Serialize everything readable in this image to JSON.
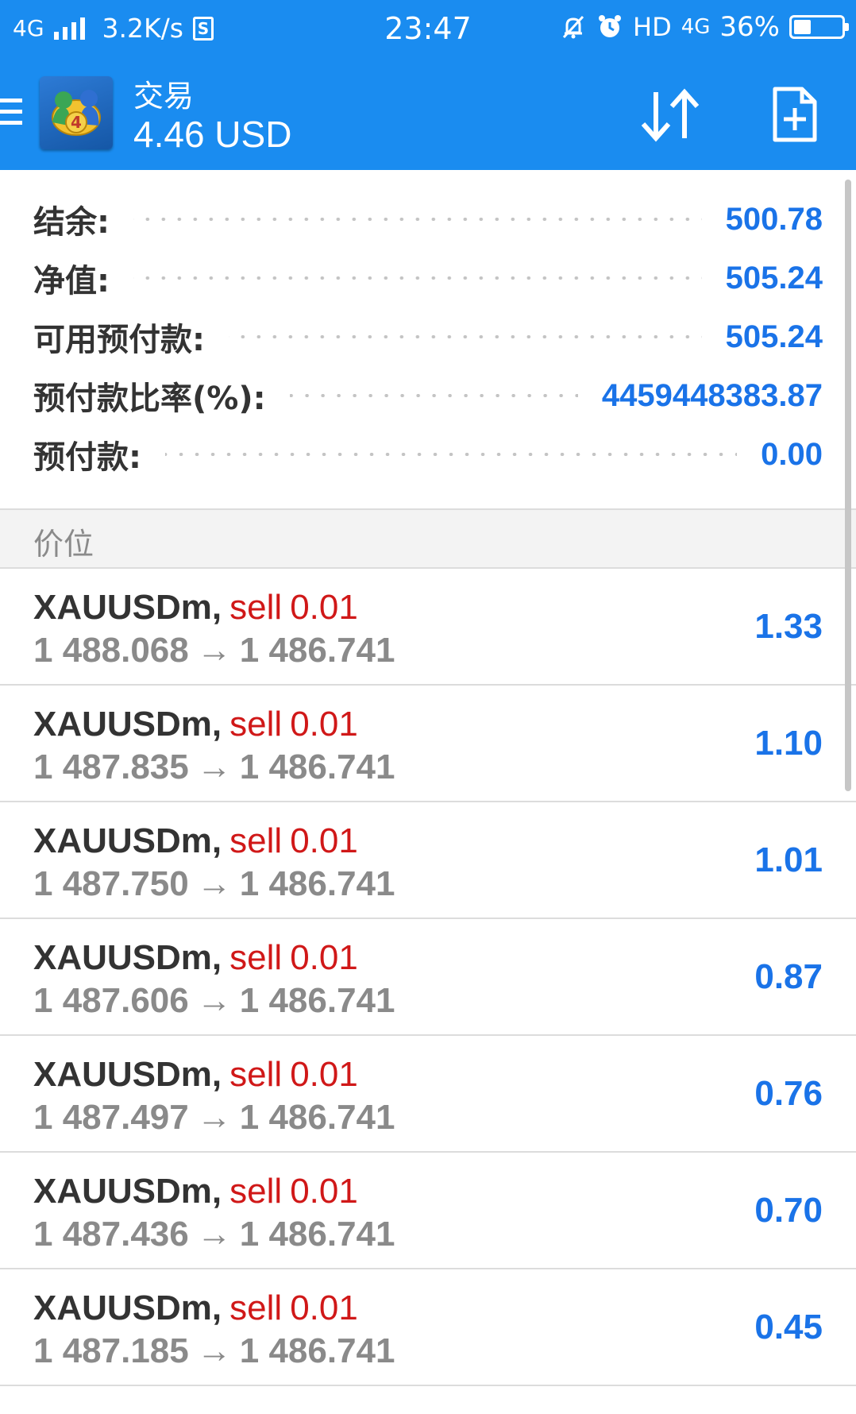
{
  "status_bar": {
    "network": "4G",
    "speed": "3.2K/s",
    "sim_label": "S",
    "time": "23:47",
    "hd": "HD",
    "network2": "4G",
    "battery_percent": "36%",
    "battery_level": 0.36
  },
  "app_bar": {
    "title": "交易",
    "subtitle": "4.46 USD",
    "logo_badge": "4"
  },
  "summary": [
    {
      "label": "结余:",
      "value": "500.78"
    },
    {
      "label": "净值:",
      "value": "505.24"
    },
    {
      "label": "可用预付款:",
      "value": "505.24"
    },
    {
      "label": "预付款比率(%):",
      "value": "4459448383.87"
    },
    {
      "label": "预付款:",
      "value": "0.00"
    }
  ],
  "section_title": "价位",
  "positions": [
    {
      "symbol": "XAUUSDm",
      "side": "sell",
      "volume": "0.01",
      "open_price": "1 488.068",
      "current_price": "1 486.741",
      "profit": "1.33"
    },
    {
      "symbol": "XAUUSDm",
      "side": "sell",
      "volume": "0.01",
      "open_price": "1 487.835",
      "current_price": "1 486.741",
      "profit": "1.10"
    },
    {
      "symbol": "XAUUSDm",
      "side": "sell",
      "volume": "0.01",
      "open_price": "1 487.750",
      "current_price": "1 486.741",
      "profit": "1.01"
    },
    {
      "symbol": "XAUUSDm",
      "side": "sell",
      "volume": "0.01",
      "open_price": "1 487.606",
      "current_price": "1 486.741",
      "profit": "0.87"
    },
    {
      "symbol": "XAUUSDm",
      "side": "sell",
      "volume": "0.01",
      "open_price": "1 487.497",
      "current_price": "1 486.741",
      "profit": "0.76"
    },
    {
      "symbol": "XAUUSDm",
      "side": "sell",
      "volume": "0.01",
      "open_price": "1 487.436",
      "current_price": "1 486.741",
      "profit": "0.70"
    },
    {
      "symbol": "XAUUSDm",
      "side": "sell",
      "volume": "0.01",
      "open_price": "1 487.185",
      "current_price": "1 486.741",
      "profit": "0.45"
    }
  ],
  "icons": {
    "menu": "hamburger-menu-icon",
    "sort": "sort-arrows-icon",
    "new_order": "new-order-document-icon",
    "arrow": "right-arrow-icon"
  },
  "colors": {
    "header": "#1a8cf0",
    "value_blue": "#1a73e8",
    "sell_red": "#d01818",
    "label_dark": "#333333",
    "price_gray": "#8a8a8a"
  }
}
